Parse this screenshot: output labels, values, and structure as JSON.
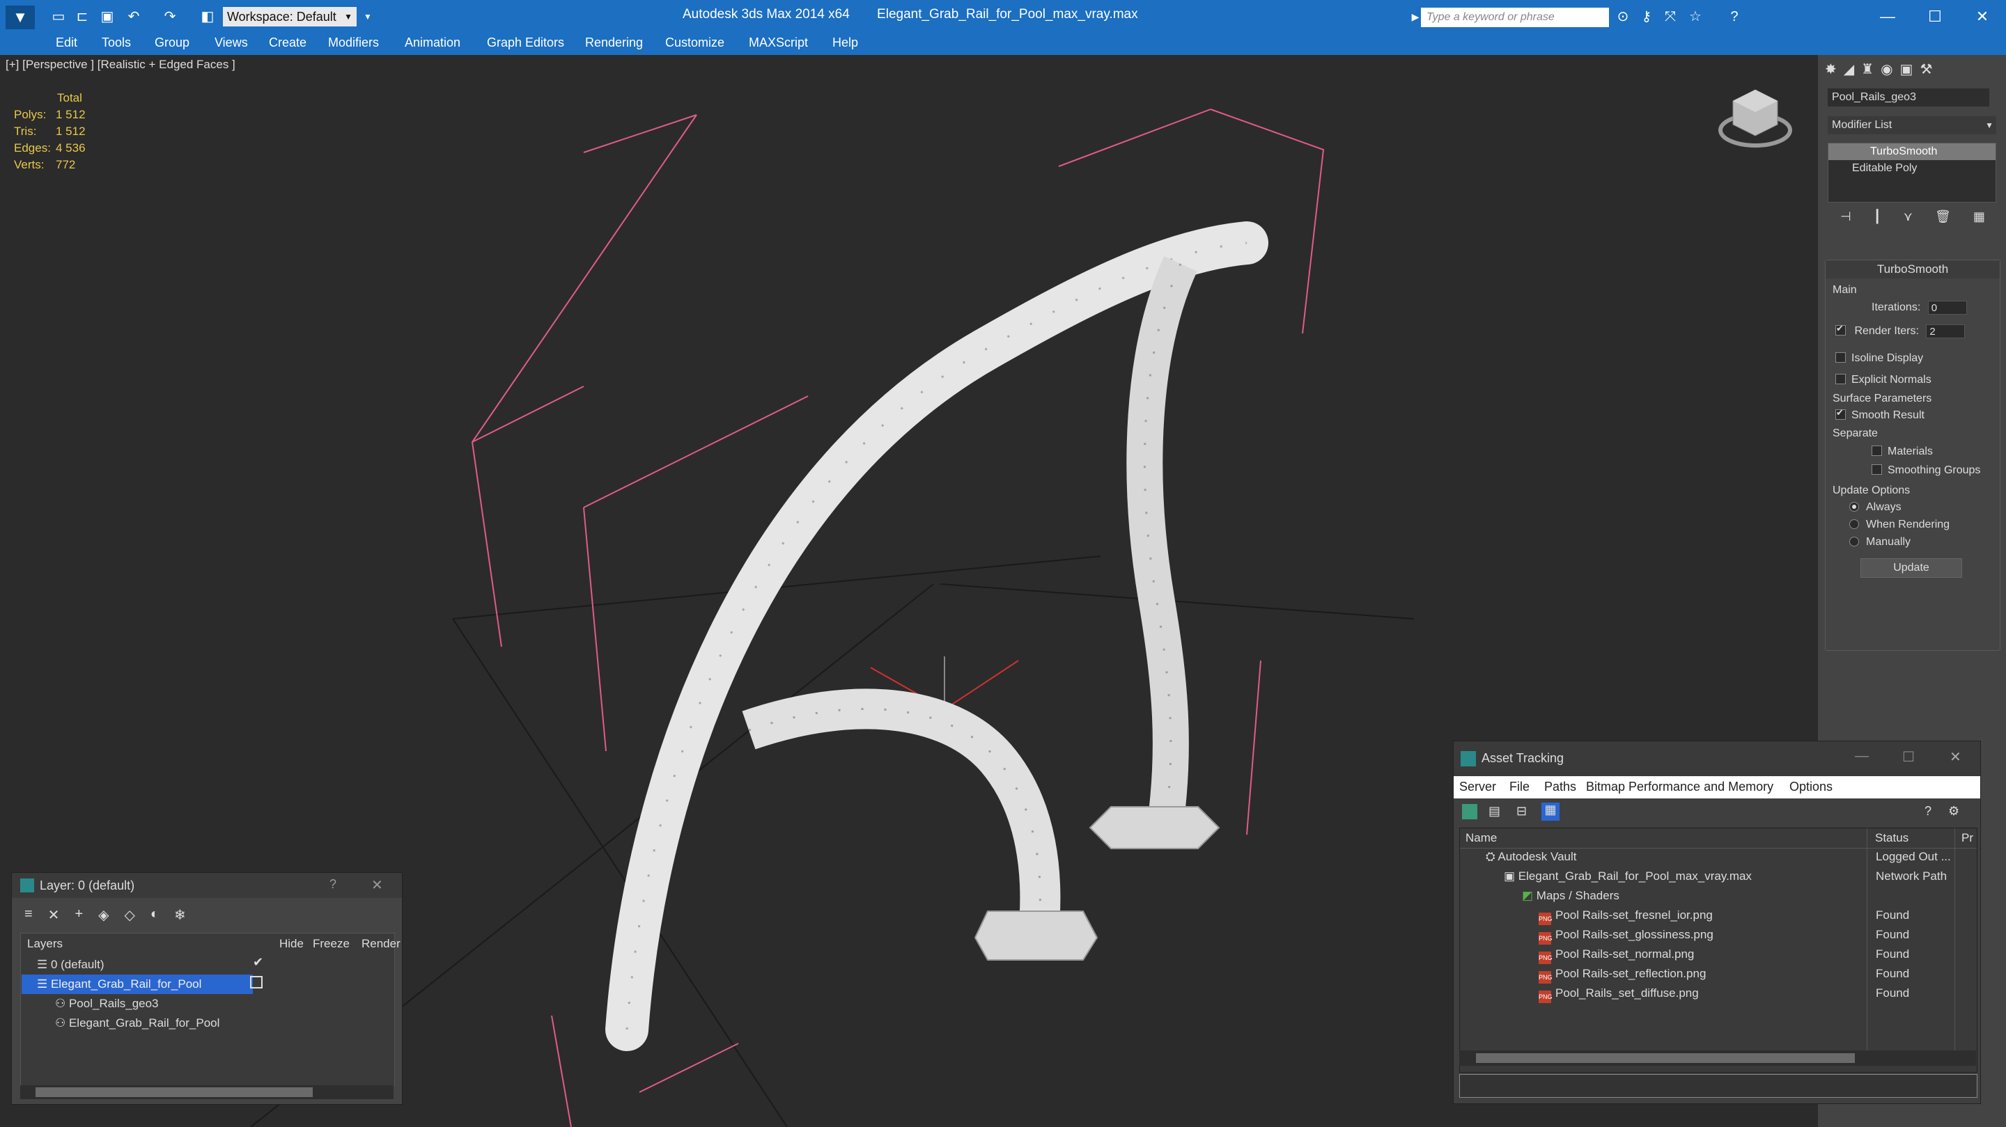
{
  "title_bar": {
    "app_name": "Autodesk 3ds Max  2014 x64",
    "file_name": "Elegant_Grab_Rail_for_Pool_max_vray.max",
    "workspace_label": "Workspace: Default",
    "search_placeholder": "Type a keyword or phrase"
  },
  "menu": {
    "items": [
      "Edit",
      "Tools",
      "Group",
      "Views",
      "Create",
      "Modifiers",
      "Animation",
      "Graph Editors",
      "Rendering",
      "Customize",
      "MAXScript",
      "Help"
    ]
  },
  "viewport": {
    "label": "[+] [Perspective ] [Realistic + Edged Faces ]",
    "stats": {
      "header": "Total",
      "rows": [
        {
          "key": "Polys:",
          "value": "1 512"
        },
        {
          "key": "Tris:",
          "value": "1 512"
        },
        {
          "key": "Edges:",
          "value": "4 536"
        },
        {
          "key": "Verts:",
          "value": "772"
        }
      ]
    }
  },
  "command_panel": {
    "object_name": "Pool_Rails_geo3",
    "modifier_list_label": "Modifier List",
    "stack": [
      "TurboSmooth",
      "Editable Poly"
    ],
    "turbosmooth": {
      "title": "TurboSmooth",
      "main_label": "Main",
      "iterations_label": "Iterations:",
      "iterations_value": "0",
      "render_iters_label": "Render Iters:",
      "render_iters_value": "2",
      "render_iters_checked": true,
      "isoline_display": "Isoline Display",
      "explicit_normals": "Explicit Normals",
      "surface_params_label": "Surface Parameters",
      "smooth_result": "Smooth Result",
      "separate_label": "Separate",
      "materials": "Materials",
      "smoothing_groups": "Smoothing Groups",
      "update_options_label": "Update Options",
      "always": "Always",
      "when_rendering": "When Rendering",
      "manually": "Manually",
      "update_button": "Update"
    }
  },
  "layer_window": {
    "title": "Layer: 0 (default)",
    "columns": {
      "layers": "Layers",
      "hide": "Hide",
      "freeze": "Freeze",
      "render": "Render"
    },
    "rows": [
      {
        "name": "0 (default)",
        "selected": false
      },
      {
        "name": "Elegant_Grab_Rail_for_Pool",
        "selected": true
      },
      {
        "name": "Pool_Rails_geo3",
        "selected": false
      },
      {
        "name": "Elegant_Grab_Rail_for_Pool",
        "selected": false
      }
    ]
  },
  "asset_tracking": {
    "title": "Asset Tracking",
    "menus": [
      "Server",
      "File",
      "Paths",
      "Bitmap Performance and Memory",
      "Options"
    ],
    "columns": {
      "name": "Name",
      "status": "Status",
      "extra": "Pr"
    },
    "rows": [
      {
        "name": "Autodesk Vault",
        "status": "Logged Out ..."
      },
      {
        "name": "Elegant_Grab_Rail_for_Pool_max_vray.max",
        "status": "Network Path"
      },
      {
        "name": "Maps / Shaders",
        "status": ""
      },
      {
        "name": "Pool Rails-set_fresnel_ior.png",
        "status": "Found"
      },
      {
        "name": "Pool Rails-set_glossiness.png",
        "status": "Found"
      },
      {
        "name": "Pool Rails-set_normal.png",
        "status": "Found"
      },
      {
        "name": "Pool Rails-set_reflection.png",
        "status": "Found"
      },
      {
        "name": "Pool_Rails_set_diffuse.png",
        "status": "Found"
      }
    ]
  },
  "colors": {
    "titlebar": "#1c6fc1",
    "selection": "#2a66d0",
    "stats_text": "#e8c84a",
    "bbox_lines": "#e05b8a"
  }
}
